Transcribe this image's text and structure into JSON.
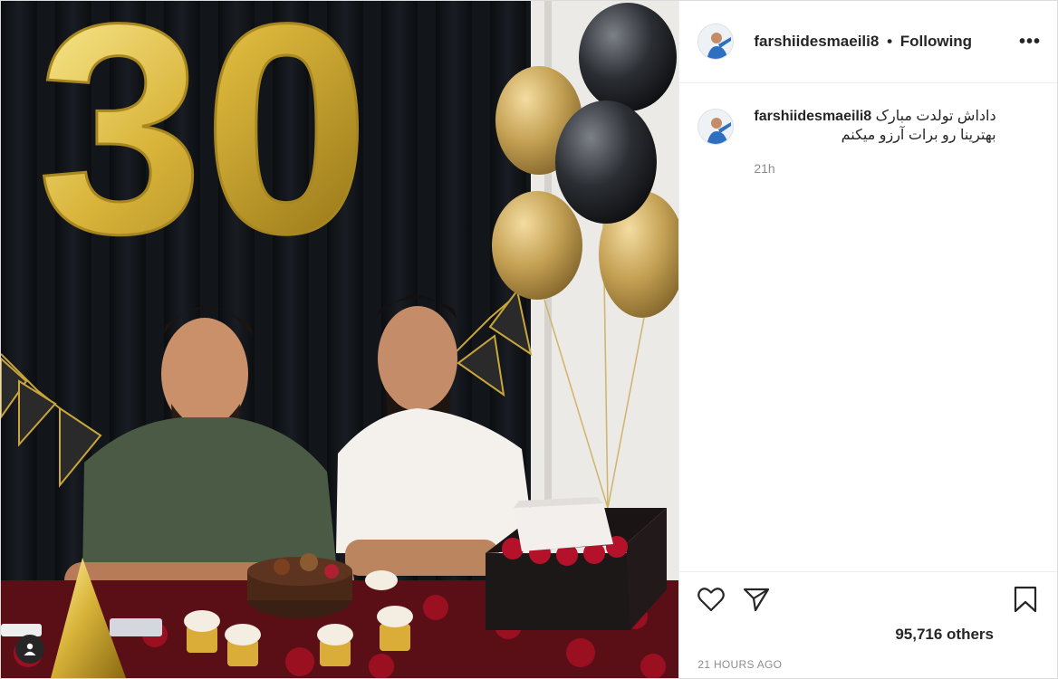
{
  "header": {
    "username": "farshiidesmaeili8",
    "separator": "•",
    "follow_status": "Following",
    "more_label": "•••"
  },
  "caption": {
    "username": "farshiidesmaeili8",
    "text_line1": "داداش تولدت مبارک",
    "text_line2": "بهترینا رو برات آرزو میکنم",
    "time": "21h"
  },
  "photo": {
    "balloon_numbers": "30",
    "colors": {
      "gold": "#d4b23a",
      "backdrop": "#12151a",
      "shirt_green": "#4a5a45",
      "shirt_white": "#f4f1ec",
      "roses": "#9b1020"
    }
  },
  "actions": {
    "like_icon": "heart-icon",
    "share_icon": "paper-plane-icon",
    "save_icon": "bookmark-icon"
  },
  "likes_text": "95,716 others",
  "date_text": "21 HOURS AGO"
}
